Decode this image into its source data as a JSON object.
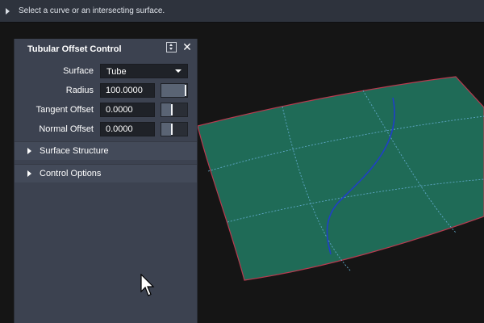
{
  "prompt": {
    "text": "Select a curve or an intersecting surface."
  },
  "panel": {
    "title": "Tubular Offset Control",
    "pin_icon": "pin-arrows-icon",
    "close_icon": "close-icon",
    "close_glyph": "✕",
    "surface": {
      "label": "Surface",
      "value": "Tube"
    },
    "radius": {
      "label": "Radius",
      "value": "100.0000",
      "slider_level": 0.95
    },
    "tangent_offset": {
      "label": "Tangent Offset",
      "value": "0.0000",
      "slider_level": 0.4
    },
    "normal_offset": {
      "label": "Normal Offset",
      "value": "0.0000",
      "slider_level": 0.4
    },
    "sections": [
      {
        "label": "Surface Structure",
        "expanded": false
      },
      {
        "label": "Control Options",
        "expanded": false
      }
    ]
  },
  "colors": {
    "surface_fill": "#1f6b57",
    "surface_edge": "#b83a4f",
    "isoparm": "#5fa8c8",
    "curve": "#1f3fc8",
    "panel_bg": "#3c4250"
  }
}
